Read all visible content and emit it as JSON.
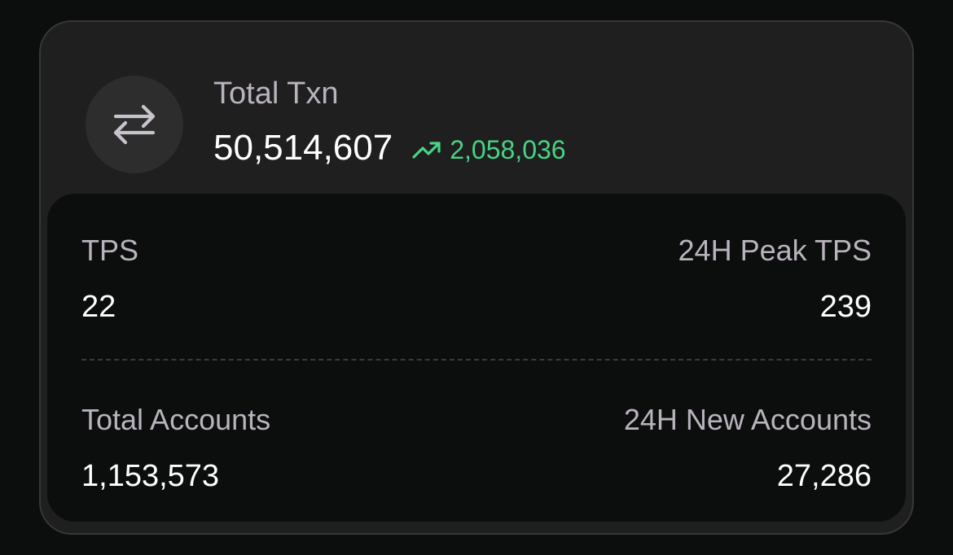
{
  "total_txn": {
    "icon": "arrows-exchange-icon",
    "label": "Total Txn",
    "value": "50,514,607",
    "change": {
      "icon": "trending-up-icon",
      "value": "2,058,036",
      "color": "#47d486"
    }
  },
  "stats": {
    "tps": {
      "label": "TPS",
      "value": "22"
    },
    "peak_tps": {
      "label": "24H Peak TPS",
      "value": "239"
    },
    "total_accounts": {
      "label": "Total Accounts",
      "value": "1,153,573"
    },
    "new_accounts": {
      "label": "24H New Accounts",
      "value": "27,286"
    }
  },
  "colors": {
    "background": "#0c0d0d",
    "card": "#1f1f1f",
    "label": "#b9b3bd",
    "value": "#ffffff",
    "positive": "#47d486"
  }
}
